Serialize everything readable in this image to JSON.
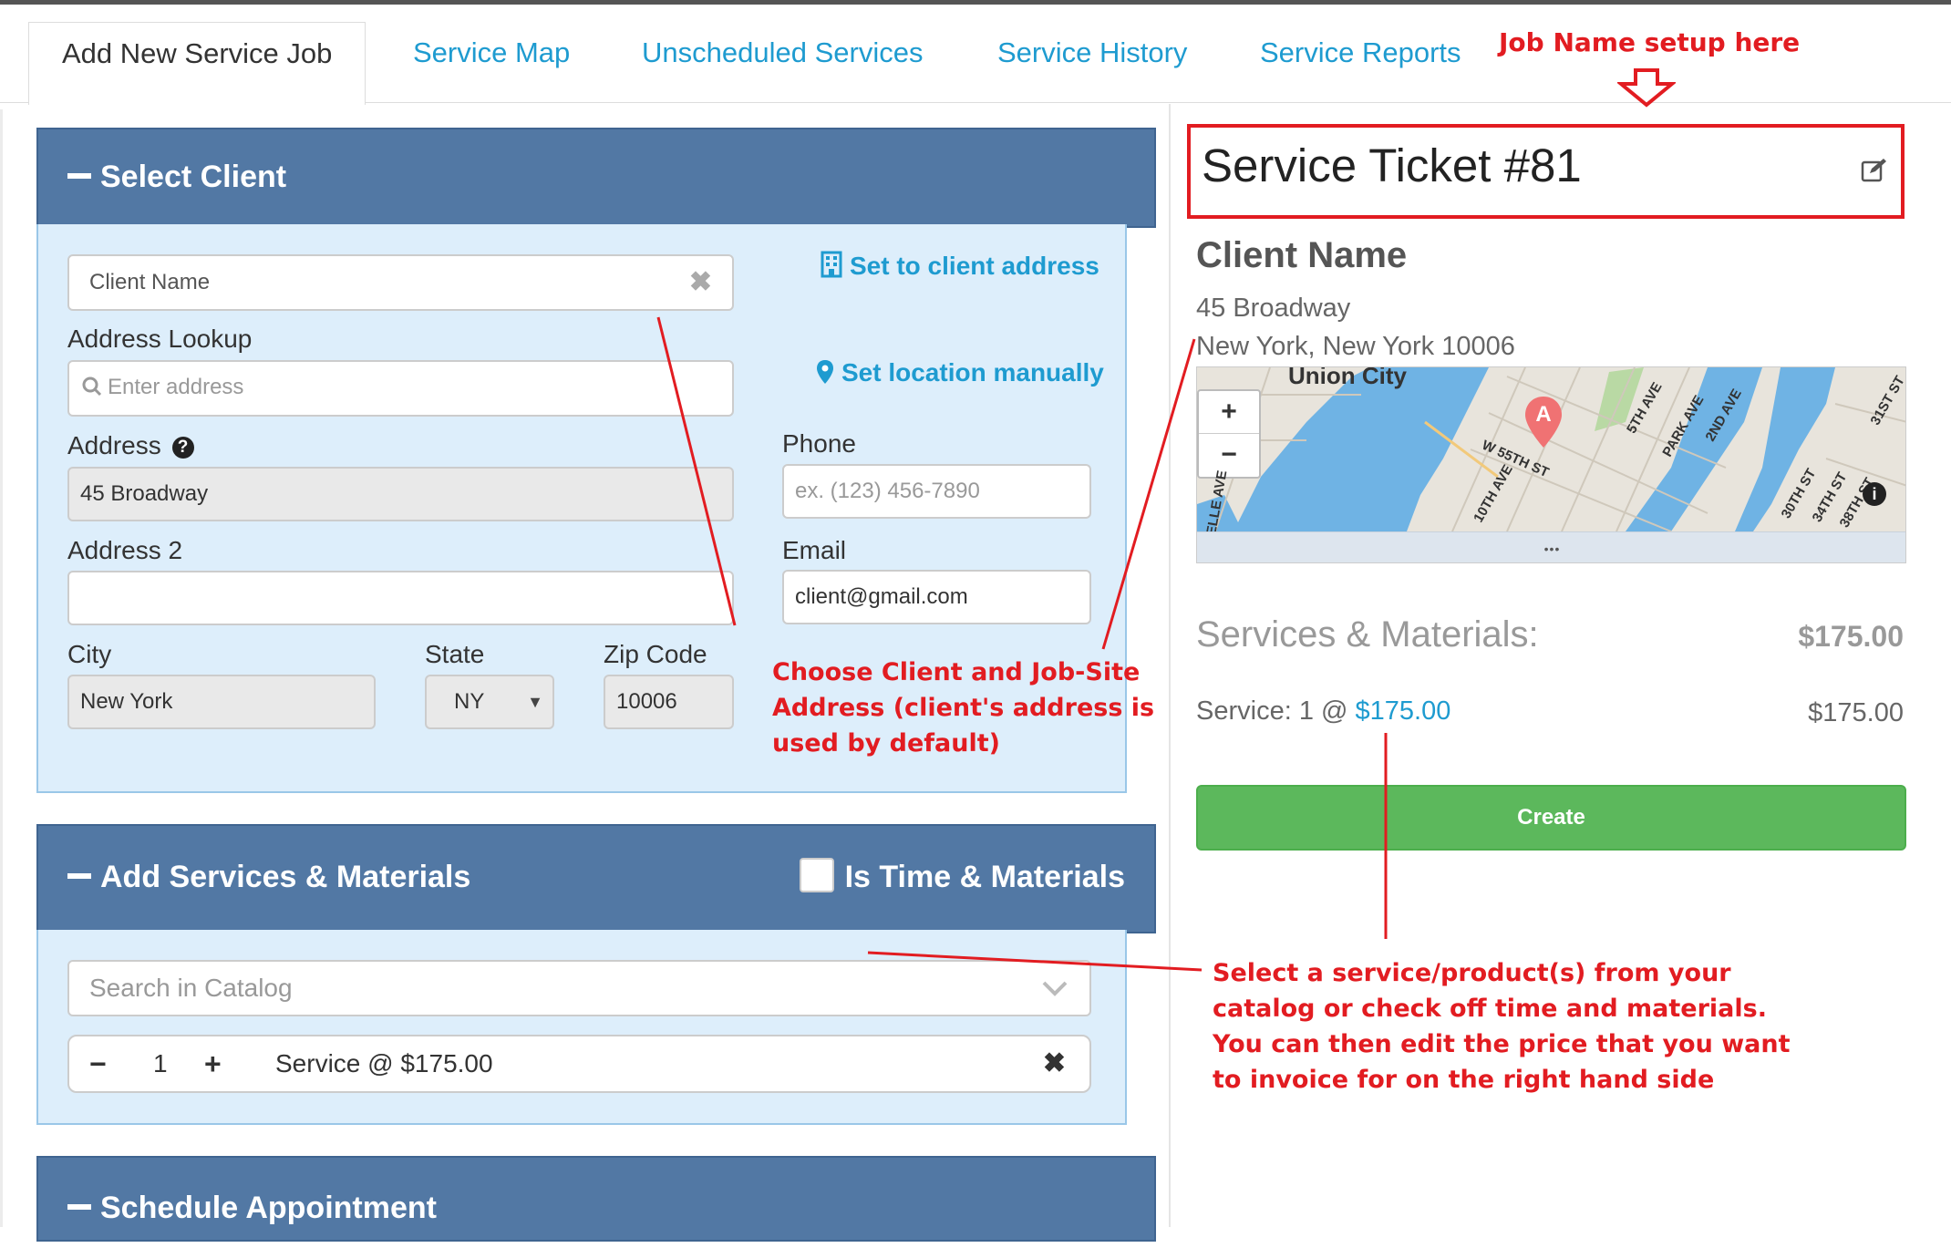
{
  "tabs": [
    {
      "label": "Add New Service Job",
      "active": true
    },
    {
      "label": "Service Map"
    },
    {
      "label": "Unscheduled Services"
    },
    {
      "label": "Service History"
    },
    {
      "label": "Service Reports"
    }
  ],
  "client_panel": {
    "title": "Select Client",
    "client_name_placeholder": "Client Name",
    "set_to_client_address": "Set to client address",
    "set_location_manually": "Set location manually",
    "address_lookup_label": "Address Lookup",
    "address_lookup_placeholder": "Enter address",
    "address_label": "Address",
    "address_value": "45 Broadway",
    "address2_label": "Address 2",
    "address2_value": "",
    "city_label": "City",
    "city_value": "New York",
    "state_label": "State",
    "state_value": "NY",
    "zip_label": "Zip Code",
    "zip_value": "10006",
    "phone_label": "Phone",
    "phone_placeholder": "ex. (123) 456-7890",
    "email_label": "Email",
    "email_value": "client@gmail.com"
  },
  "services_panel": {
    "title": "Add Services & Materials",
    "time_materials_label": "Is Time & Materials",
    "time_materials_checked": false,
    "catalog_placeholder": "Search in Catalog",
    "line_item": {
      "qty": "1",
      "description": "Service @ $175.00"
    }
  },
  "schedule_panel": {
    "title": "Schedule Appointment"
  },
  "ticket": {
    "title": "Service Ticket #81",
    "client_name": "Client Name",
    "address_line1": "45 Broadway",
    "address_line2": "New York, New York 10006",
    "services_heading": "Services & Materials:",
    "services_total": "$175.00",
    "service_line_prefix": "Service: 1 @",
    "service_line_price": "$175.00",
    "service_line_total": "$175.00",
    "create_label": "Create"
  },
  "map": {
    "labels": {
      "city": "Union City",
      "marker": "A",
      "zoom_in": "+",
      "zoom_out": "−",
      "more": "•••",
      "info": "i",
      "streets": [
        "W 55TH ST",
        "10TH AVE",
        "5TH AVE",
        "PARK AVE",
        "2ND AVE",
        "31ST ST",
        "30TH ST",
        "34TH ST",
        "38TH ST",
        "ELLE AVE"
      ]
    },
    "colors": {
      "water": "#6fb3e4",
      "land": "#e8e4dc",
      "park": "#b9d9a4",
      "marker": "#f07273"
    }
  },
  "annotations": {
    "job_name": "Job Name setup here",
    "client_note": [
      "Choose Client and Job-Site",
      "Address (client's address is",
      "used by default)"
    ],
    "service_note": [
      "Select a service/product(s) from your",
      "catalog or check off time and materials.",
      "You can then edit the price that you want",
      "to invoice for on the right hand side"
    ]
  },
  "colors": {
    "accent_link": "#1e9bd0",
    "panel_header": "#5278a4",
    "panel_body": "#ddeefb",
    "create_button": "#5cb85c",
    "annotation_red": "#e21c21"
  }
}
